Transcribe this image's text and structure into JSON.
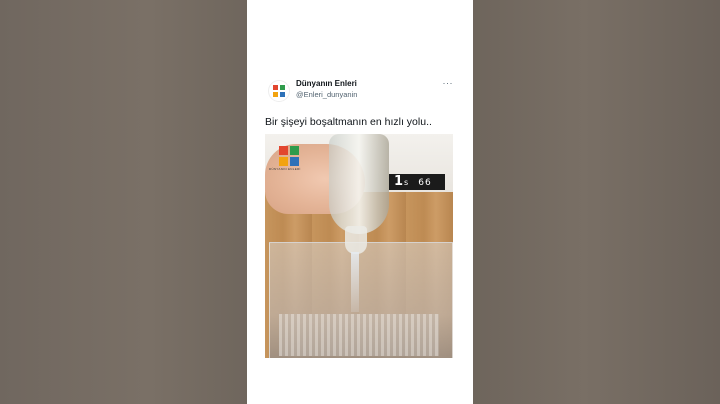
{
  "tweet": {
    "author_name": "Dünyanın Enleri",
    "author_handle": "@Enleri_dunyanin",
    "more_label": "···",
    "text": "Bir şişeyi boşaltmanın en hızlı yolu..",
    "avatar_icon": "logo-grid-icon"
  },
  "video": {
    "timer_seconds": "1",
    "timer_unit": "s",
    "timer_fraction": "66",
    "logo_colors": [
      "#e2462f",
      "#2f9b4b",
      "#f2a30f",
      "#2d71b8"
    ],
    "logo_caption": "DÜNYANIN ENLERİ"
  },
  "colors": {
    "card_bg": "#ffffff",
    "text_primary": "#0f1419",
    "text_secondary": "#536471"
  }
}
